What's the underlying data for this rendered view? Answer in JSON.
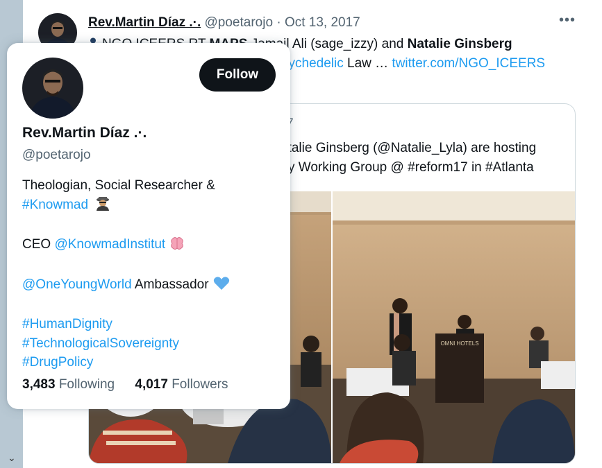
{
  "tweet": {
    "author_name": "Rev.Martin Díaz .·.",
    "author_handle": "@poetarojo",
    "separator": "·",
    "date": "Oct 13, 2017",
    "more_label": "•••",
    "text_line1_prefix": "NGO ICEERS RT",
    "text_line1_bold_a": "MAPS",
    "text_line1_mid": "Jamail Ali (sage_izzy) and",
    "text_line1_bold_b": "Natalie Ginsberg",
    "text_line2_link_a": "sychedelic",
    "text_line2_mid": "Law …",
    "text_line2_link_b": "twitter.com/NGO_ICEERS"
  },
  "quote": {
    "date_fragment": "017",
    "line1": "atalie Ginsberg (@Natalie_Lyla) are hosting",
    "line2_a": "y Working Group @",
    "line2_tag1": "#reform17",
    "line2_mid": "in",
    "line2_tag2": "#Atlanta",
    "sign_text": "OMNI HOTELS"
  },
  "hover_card": {
    "follow_label": "Follow",
    "name": "Rev.Martin Díaz .·.",
    "handle": "@poetarojo",
    "bio_line1": "Theologian, Social Researcher &",
    "bio_tag_knowmad": "#Knowmad",
    "bio_ceo": "CEO",
    "bio_mention_institut": "@KnowmadInstitut",
    "bio_mention_oyw": "@OneYoungWorld",
    "bio_ambassador": "Ambassador",
    "bio_tag_dignity": "#HumanDignity",
    "bio_tag_sovereignty": "#TechnologicalSovereignty",
    "bio_tag_drug": "#DrugPolicy",
    "following_count": "3,483",
    "following_label": "Following",
    "followers_count": "4,017",
    "followers_label": "Followers"
  },
  "icons": [
    "person-icon",
    "detective-emoji-icon",
    "brain-emoji-icon",
    "blue-heart-emoji-icon",
    "chevron-down-icon"
  ],
  "colors": {
    "link": "#1d9bf0",
    "text": "#0f1419",
    "muted": "#536471",
    "rail": "#b8c8d3",
    "follow_bg": "#0f1419"
  }
}
